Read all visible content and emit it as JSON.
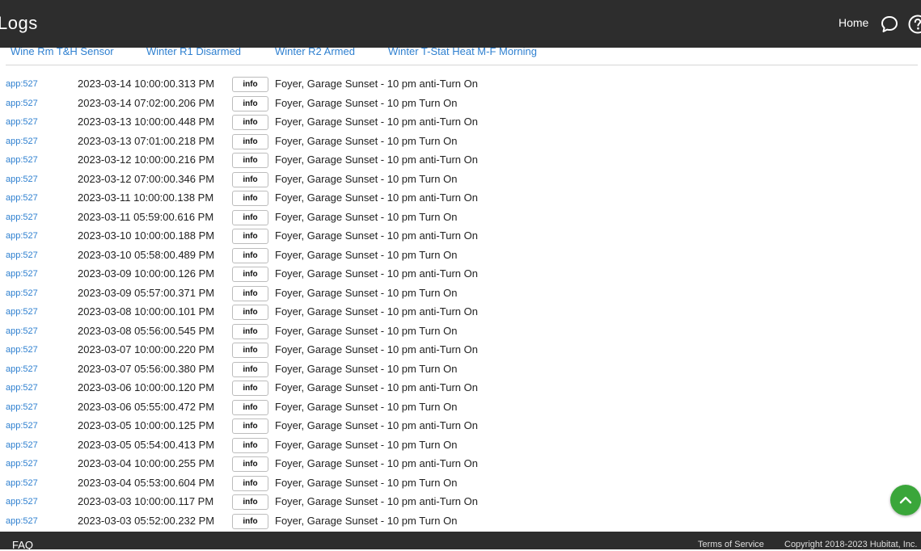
{
  "header": {
    "title": "Logs",
    "home_label": "Home"
  },
  "filters": [
    "Wine Rm T&H Sensor",
    "Winter R1 Disarmed",
    "Winter R2 Armed",
    "Winter T-Stat Heat M-F Morning"
  ],
  "logs": [
    {
      "source": "app:527",
      "timestamp": "2023-03-14 10:00:00.313 PM",
      "level": "info",
      "message": "Foyer, Garage Sunset - 10 pm anti-Turn On"
    },
    {
      "source": "app:527",
      "timestamp": "2023-03-14 07:02:00.206 PM",
      "level": "info",
      "message": "Foyer, Garage Sunset - 10 pm Turn On"
    },
    {
      "source": "app:527",
      "timestamp": "2023-03-13 10:00:00.448 PM",
      "level": "info",
      "message": "Foyer, Garage Sunset - 10 pm anti-Turn On"
    },
    {
      "source": "app:527",
      "timestamp": "2023-03-13 07:01:00.218 PM",
      "level": "info",
      "message": "Foyer, Garage Sunset - 10 pm Turn On"
    },
    {
      "source": "app:527",
      "timestamp": "2023-03-12 10:00:00.216 PM",
      "level": "info",
      "message": "Foyer, Garage Sunset - 10 pm anti-Turn On"
    },
    {
      "source": "app:527",
      "timestamp": "2023-03-12 07:00:00.346 PM",
      "level": "info",
      "message": "Foyer, Garage Sunset - 10 pm Turn On"
    },
    {
      "source": "app:527",
      "timestamp": "2023-03-11 10:00:00.138 PM",
      "level": "info",
      "message": "Foyer, Garage Sunset - 10 pm anti-Turn On"
    },
    {
      "source": "app:527",
      "timestamp": "2023-03-11 05:59:00.616 PM",
      "level": "info",
      "message": "Foyer, Garage Sunset - 10 pm Turn On"
    },
    {
      "source": "app:527",
      "timestamp": "2023-03-10 10:00:00.188 PM",
      "level": "info",
      "message": "Foyer, Garage Sunset - 10 pm anti-Turn On"
    },
    {
      "source": "app:527",
      "timestamp": "2023-03-10 05:58:00.489 PM",
      "level": "info",
      "message": "Foyer, Garage Sunset - 10 pm Turn On"
    },
    {
      "source": "app:527",
      "timestamp": "2023-03-09 10:00:00.126 PM",
      "level": "info",
      "message": "Foyer, Garage Sunset - 10 pm anti-Turn On"
    },
    {
      "source": "app:527",
      "timestamp": "2023-03-09 05:57:00.371 PM",
      "level": "info",
      "message": "Foyer, Garage Sunset - 10 pm Turn On"
    },
    {
      "source": "app:527",
      "timestamp": "2023-03-08 10:00:00.101 PM",
      "level": "info",
      "message": "Foyer, Garage Sunset - 10 pm anti-Turn On"
    },
    {
      "source": "app:527",
      "timestamp": "2023-03-08 05:56:00.545 PM",
      "level": "info",
      "message": "Foyer, Garage Sunset - 10 pm Turn On"
    },
    {
      "source": "app:527",
      "timestamp": "2023-03-07 10:00:00.220 PM",
      "level": "info",
      "message": "Foyer, Garage Sunset - 10 pm anti-Turn On"
    },
    {
      "source": "app:527",
      "timestamp": "2023-03-07 05:56:00.380 PM",
      "level": "info",
      "message": "Foyer, Garage Sunset - 10 pm Turn On"
    },
    {
      "source": "app:527",
      "timestamp": "2023-03-06 10:00:00.120 PM",
      "level": "info",
      "message": "Foyer, Garage Sunset - 10 pm anti-Turn On"
    },
    {
      "source": "app:527",
      "timestamp": "2023-03-06 05:55:00.472 PM",
      "level": "info",
      "message": "Foyer, Garage Sunset - 10 pm Turn On"
    },
    {
      "source": "app:527",
      "timestamp": "2023-03-05 10:00:00.125 PM",
      "level": "info",
      "message": "Foyer, Garage Sunset - 10 pm anti-Turn On"
    },
    {
      "source": "app:527",
      "timestamp": "2023-03-05 05:54:00.413 PM",
      "level": "info",
      "message": "Foyer, Garage Sunset - 10 pm Turn On"
    },
    {
      "source": "app:527",
      "timestamp": "2023-03-04 10:00:00.255 PM",
      "level": "info",
      "message": "Foyer, Garage Sunset - 10 pm anti-Turn On"
    },
    {
      "source": "app:527",
      "timestamp": "2023-03-04 05:53:00.604 PM",
      "level": "info",
      "message": "Foyer, Garage Sunset - 10 pm Turn On"
    },
    {
      "source": "app:527",
      "timestamp": "2023-03-03 10:00:00.117 PM",
      "level": "info",
      "message": "Foyer, Garage Sunset - 10 pm anti-Turn On"
    },
    {
      "source": "app:527",
      "timestamp": "2023-03-03 05:52:00.232 PM",
      "level": "info",
      "message": "Foyer, Garage Sunset - 10 pm Turn On"
    }
  ],
  "footer": {
    "faq": "FAQ",
    "terms": "Terms of Service",
    "copyright": "Copyright 2018-2023 Hubitat, Inc."
  },
  "colors": {
    "topbar": "#2d2d2d",
    "link": "#2f80d0",
    "scroll_button": "#3aa63a"
  },
  "icons": {
    "chat": "chat-bubble-icon",
    "help": "help-icon",
    "scroll_top": "chevron-up-icon"
  }
}
